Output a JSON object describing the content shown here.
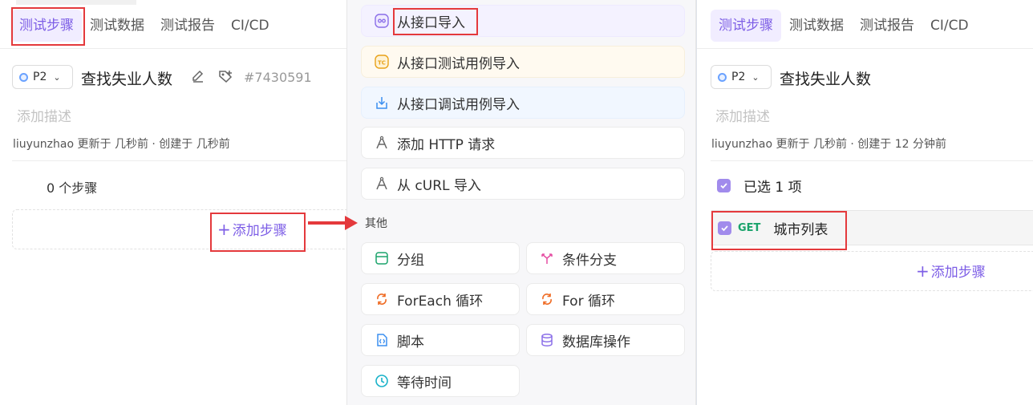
{
  "left": {
    "tabs": [
      "测试步骤",
      "测试数据",
      "测试报告",
      "CI/CD"
    ],
    "priority": "P2",
    "title": "查找失业人数",
    "case_id": "#7430591",
    "description_placeholder": "添加描述",
    "meta": "liuyunzhao 更新于 几秒前 · 创建于 几秒前",
    "steps_count": "0 个步骤",
    "add_step": "添加步骤"
  },
  "menu": {
    "items": [
      {
        "label": "从接口导入",
        "icon": "api-import-icon",
        "color": "#8a6ee8"
      },
      {
        "label": "从接口测试用例导入",
        "icon": "testcase-icon",
        "color": "#e8a21a"
      },
      {
        "label": "从接口调试用例导入",
        "icon": "debug-case-icon",
        "color": "#3b8ff0"
      },
      {
        "label": "添加 HTTP 请求",
        "icon": "http-icon",
        "color": "#666666"
      },
      {
        "label": "从 cURL 导入",
        "icon": "curl-icon",
        "color": "#666666"
      }
    ],
    "other_section": "其他",
    "other_items": [
      {
        "label": "分组",
        "icon": "group-icon",
        "color": "#1aa36b"
      },
      {
        "label": "条件分支",
        "icon": "branch-icon",
        "color": "#e54fa3"
      },
      {
        "label": "ForEach 循环",
        "icon": "foreach-icon",
        "color": "#ef6a22"
      },
      {
        "label": "For 循环",
        "icon": "for-loop-icon",
        "color": "#ef6a22"
      },
      {
        "label": "脚本",
        "icon": "script-icon",
        "color": "#3b8ff0"
      },
      {
        "label": "数据库操作",
        "icon": "database-icon",
        "color": "#8a6ee8"
      },
      {
        "label": "等待时间",
        "icon": "clock-icon",
        "color": "#19b2c9"
      }
    ]
  },
  "right": {
    "tabs": [
      "测试步骤",
      "测试数据",
      "测试报告",
      "CI/CD"
    ],
    "priority": "P2",
    "title": "查找失业人数",
    "description_placeholder": "添加描述",
    "meta": "liuyunzhao 更新于 几秒前 · 创建于 12 分钟前",
    "selected": "已选 1 项",
    "step_method": "GET",
    "step_name": "城市列表",
    "add_step": "添加步骤"
  },
  "colors": {
    "accent": "#7d5ee6",
    "annotation": "#e4393c",
    "get": "#1aa36b"
  }
}
